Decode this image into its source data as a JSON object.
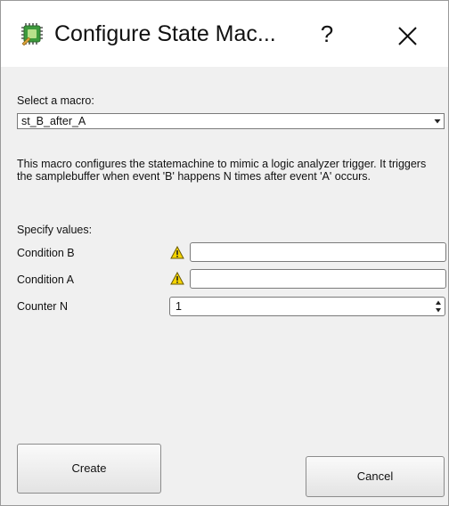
{
  "window": {
    "title": "Configure State Mac...",
    "help_label": "?",
    "icon": "chip-icon"
  },
  "macro": {
    "label": "Select a macro:",
    "selected": "st_B_after_A"
  },
  "description": "This macro configures the statemachine to mimic a logic analyzer trigger. It triggers the samplebuffer when event 'B' happens N times after event 'A' occurs.",
  "values": {
    "label": "Specify values:",
    "fields": [
      {
        "label": "Condition B",
        "value": "",
        "warning": true
      },
      {
        "label": "Condition A",
        "value": "",
        "warning": true
      },
      {
        "label": "Counter N",
        "value": "1"
      }
    ]
  },
  "buttons": {
    "create": "Create",
    "cancel": "Cancel"
  },
  "colors": {
    "warning": "#f5d400",
    "chip": "#3c9a3c"
  }
}
